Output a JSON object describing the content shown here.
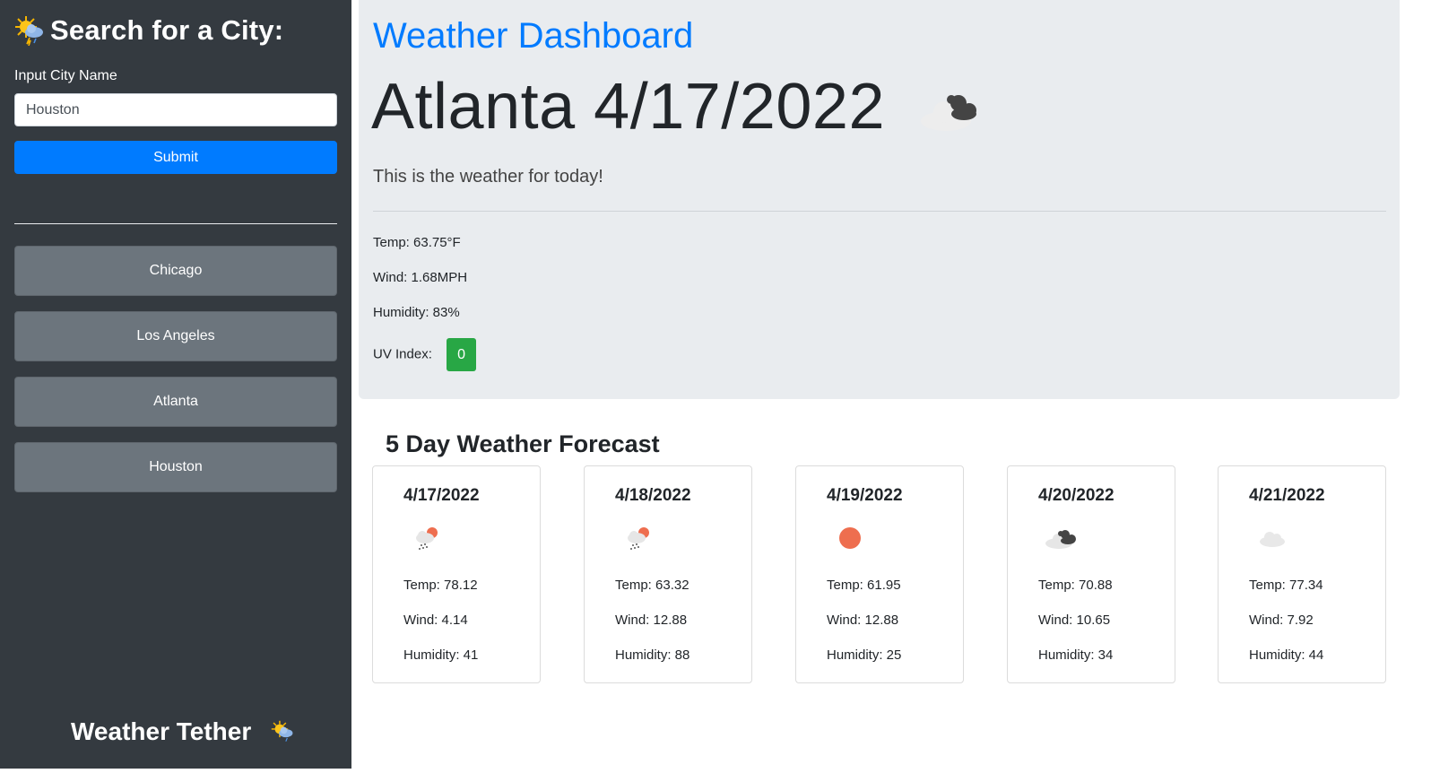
{
  "sidebar": {
    "title": "Search for a City:",
    "title_icon": "sun-cloud-rain-icon",
    "input_label": "Input City Name",
    "input_value": "Houston",
    "input_placeholder": "",
    "submit_label": "Submit",
    "history": [
      "Chicago",
      "Los Angeles",
      "Atlanta",
      "Houston"
    ],
    "footer_brand": "Weather Tether",
    "footer_icon": "sun-cloud-rain-icon"
  },
  "current": {
    "dashboard_title": "Weather Dashboard",
    "city": "Atlanta",
    "date": "4/17/2022",
    "icon": "broken-clouds-icon",
    "lead": "This is the weather for today!",
    "temp": "Temp: 63.75°F",
    "wind": "Wind: 1.68MPH",
    "humidity": "Humidity: 83%",
    "uv_label": "UV Index:",
    "uv_value": "0",
    "uv_color": "#28a745"
  },
  "forecast": {
    "title": "5 Day Weather Forecast",
    "days": [
      {
        "date": "4/17/2022",
        "icon": "light-rain-icon",
        "temp": "Temp: 78.12",
        "wind": "Wind: 4.14",
        "humidity": "Humidity: 41"
      },
      {
        "date": "4/18/2022",
        "icon": "light-rain-icon",
        "temp": "Temp: 63.32",
        "wind": "Wind: 12.88",
        "humidity": "Humidity: 88"
      },
      {
        "date": "4/19/2022",
        "icon": "clear-sun-icon",
        "temp": "Temp: 61.95",
        "wind": "Wind: 12.88",
        "humidity": "Humidity: 25"
      },
      {
        "date": "4/20/2022",
        "icon": "broken-clouds-icon",
        "temp": "Temp: 70.88",
        "wind": "Wind: 10.65",
        "humidity": "Humidity: 34"
      },
      {
        "date": "4/21/2022",
        "icon": "cloud-icon",
        "temp": "Temp: 77.34",
        "wind": "Wind: 7.92",
        "humidity": "Humidity: 44"
      }
    ]
  },
  "colors": {
    "sidebar_bg": "#343a40",
    "primary": "#007bff",
    "secondary": "#6c757d",
    "jumbotron_bg": "#e9ecef",
    "success": "#28a745",
    "sun": "#ee6e4f"
  }
}
